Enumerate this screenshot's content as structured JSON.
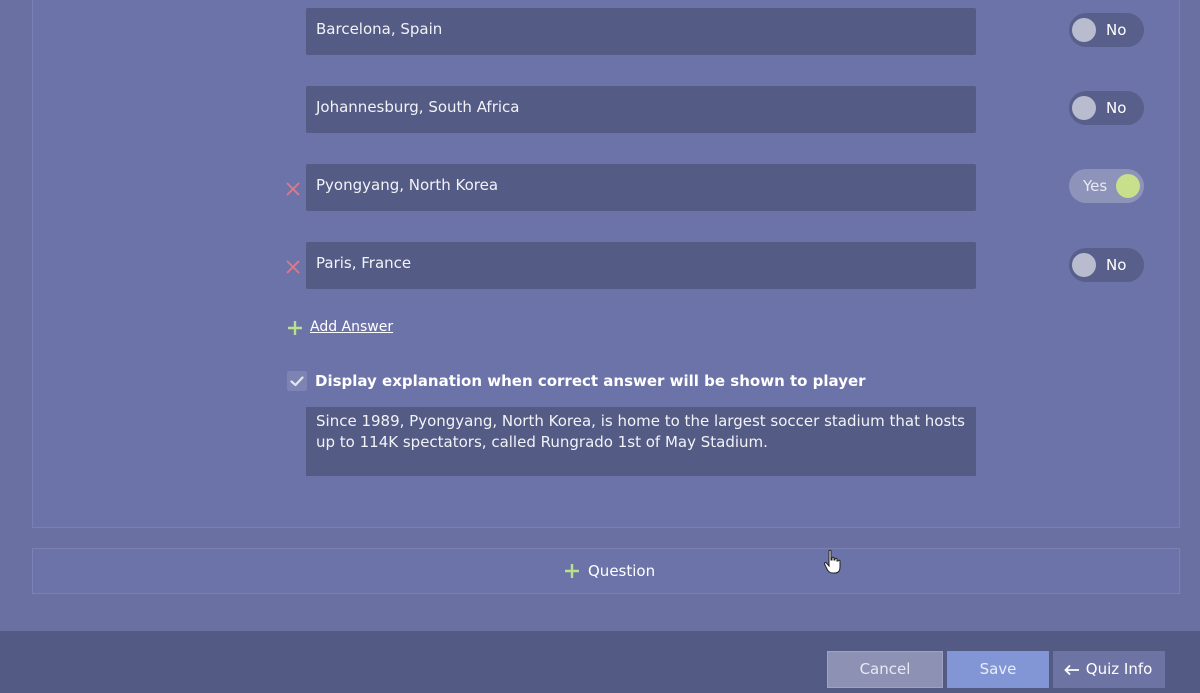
{
  "answers": [
    {
      "text": "Barcelona, Spain",
      "toggle": "No",
      "correct": false,
      "removable": false
    },
    {
      "text": "Johannesburg, South Africa",
      "toggle": "No",
      "correct": false,
      "removable": false
    },
    {
      "text": "Pyongyang, North Korea",
      "toggle": "Yes",
      "correct": true,
      "removable": true
    },
    {
      "text": "Paris, France",
      "toggle": "No",
      "correct": false,
      "removable": true
    }
  ],
  "add_answer_label": "Add Answer",
  "explanation": {
    "checked": true,
    "label": "Display explanation when correct answer will be shown to player",
    "text": "Since 1989, Pyongyang, North Korea, is home to the largest soccer stadium that hosts up to 114K spectators, called Rungrado 1st of May Stadium."
  },
  "add_question_label": "Question",
  "footer": {
    "cancel_label": "Cancel",
    "save_label": "Save",
    "quiz_info_label": "Quiz Info"
  },
  "colors": {
    "background": "#6a70a2",
    "field": "#545b84",
    "toggle_on_knob": "#c8e08b",
    "remove_x": "#e07a86",
    "plus_accent": "#b9e08a",
    "save_button": "#8296d6"
  },
  "icons": {
    "remove": "close-icon",
    "add": "plus-icon",
    "check": "checkmark-icon",
    "back": "arrow-left-icon",
    "cursor": "hand-pointer-icon"
  }
}
